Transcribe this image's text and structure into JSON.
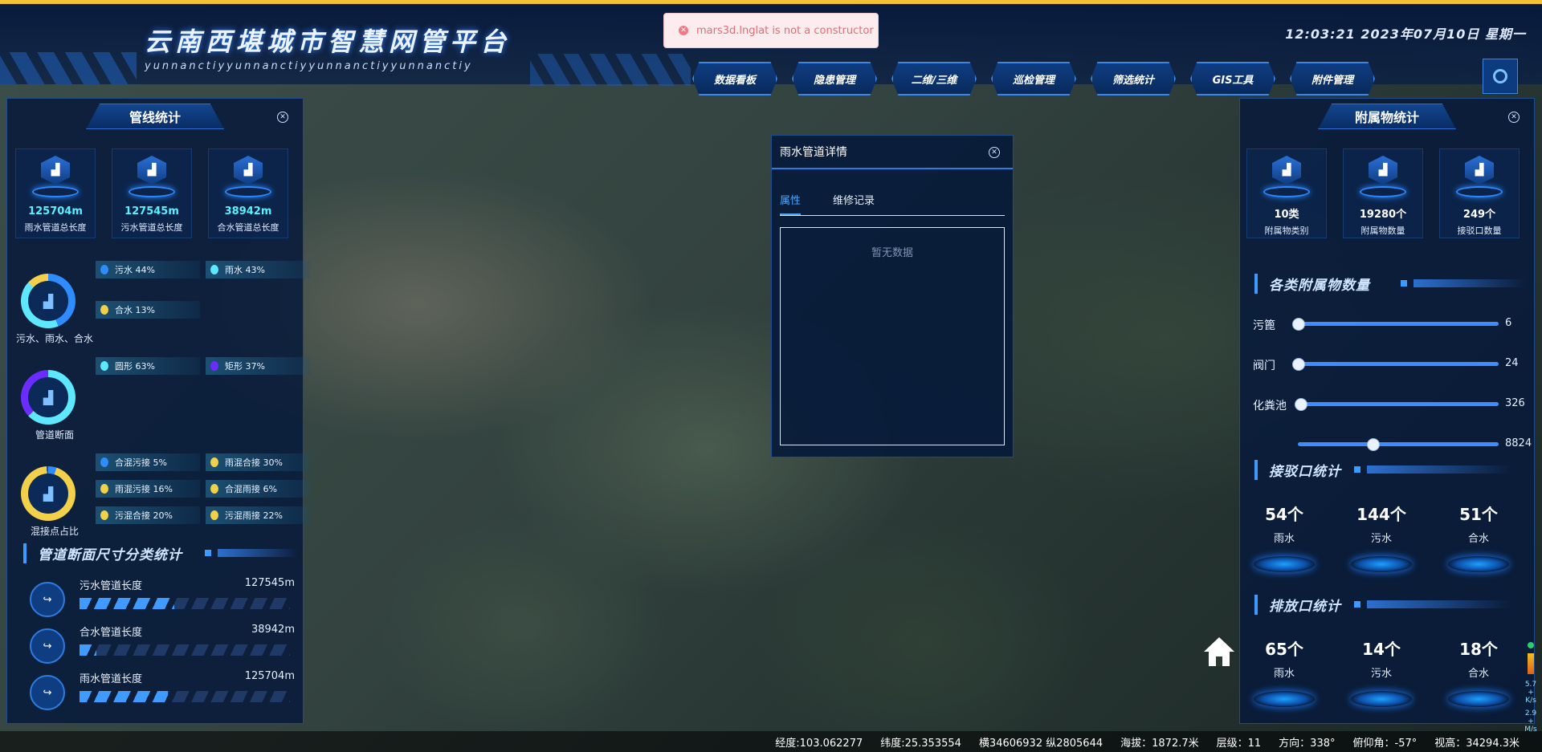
{
  "app": {
    "title": "云南西堪城市智慧网管平台",
    "subtitle": "yunnanctiyyunnanctiyyunnanctiyyunnanctiy",
    "clock": "12:03:21  2023年07月10日  星期一"
  },
  "toast": {
    "message": "mars3d.lnglat is not a constructor"
  },
  "nav": [
    "数据看板",
    "隐患管理",
    "二维/三维",
    "巡检管理",
    "筛选统计",
    "GIS工具",
    "附件管理"
  ],
  "left_panel": {
    "title": "管线统计",
    "stats": [
      {
        "value": "125704m",
        "label": "雨水管道总长度"
      },
      {
        "value": "127545m",
        "label": "污水管道总长度"
      },
      {
        "value": "38942m",
        "label": "合水管道总长度"
      }
    ],
    "donut1": {
      "label": "污水、雨水、合水",
      "tags": [
        {
          "text": "污水 44%",
          "pct": 44,
          "color": "#2f8cff"
        },
        {
          "text": "雨水 43%",
          "pct": 43,
          "color": "#5ee8ff"
        },
        {
          "text": "合水 13%",
          "pct": 13,
          "color": "#f3d04a"
        }
      ]
    },
    "donut2": {
      "label": "管道断面",
      "tags": [
        {
          "text": "圆形 63%",
          "pct": 63,
          "color": "#5ee8ff"
        },
        {
          "text": "矩形 37%",
          "pct": 37,
          "color": "#6a2cff"
        }
      ]
    },
    "donut3": {
      "label": "混接点占比",
      "tags": [
        {
          "text": "合混污接 5%",
          "pct": 5,
          "color": "#2f8cff"
        },
        {
          "text": "雨混合接 30%",
          "pct": 30,
          "color": "#f3d04a"
        },
        {
          "text": "雨混污接 16%",
          "pct": 16,
          "color": "#f3d04a"
        },
        {
          "text": "合混雨接 6%",
          "pct": 6,
          "color": "#f3d04a"
        },
        {
          "text": "污混合接 20%",
          "pct": 20,
          "color": "#f3d04a"
        },
        {
          "text": "污混雨接 22%",
          "pct": 22,
          "color": "#f3d04a"
        }
      ]
    },
    "section_title": "管道断面尺寸分类统计",
    "lengths": [
      {
        "name": "污水管道长度",
        "value": "127545m",
        "fill": 0.45
      },
      {
        "name": "合水管道长度",
        "value": "38942m",
        "fill": 0.08
      },
      {
        "name": "雨水管道长度",
        "value": "125704m",
        "fill": 0.42
      }
    ]
  },
  "detail": {
    "title": "雨水管道详情",
    "tabs": [
      "属性",
      "维修记录"
    ],
    "empty_text": "暂无数据"
  },
  "right_panel": {
    "title": "附属物统计",
    "stats": [
      {
        "value": "10类",
        "label": "附属物类别"
      },
      {
        "value": "19280个",
        "label": "附属物数量"
      },
      {
        "value": "249个",
        "label": "接驳口数量"
      }
    ],
    "section1": "各类附属物数量",
    "sliders": [
      {
        "label": "污篦",
        "value": "6",
        "pos": 0.0
      },
      {
        "label": "阀门",
        "value": "24",
        "pos": 0.0
      },
      {
        "label": "化粪池",
        "value": "326",
        "pos": 0.01
      },
      {
        "label": "",
        "value": "8824",
        "pos": 0.37
      }
    ],
    "section2": "接驳口统计",
    "connectors": [
      {
        "value": "54个",
        "label": "雨水"
      },
      {
        "value": "144个",
        "label": "污水"
      },
      {
        "value": "51个",
        "label": "合水"
      }
    ],
    "section3": "排放口统计",
    "outlets": [
      {
        "value": "65个",
        "label": "雨水"
      },
      {
        "value": "14个",
        "label": "污水"
      },
      {
        "value": "18个",
        "label": "合水"
      }
    ]
  },
  "status_bar": {
    "lng": "经度:103.062277",
    "lat": "纬度:25.353554",
    "xy": "横34606932 纵2805644",
    "alt": "海拔：1872.7米",
    "level": "层级：11",
    "heading": "方向：338°",
    "pitch": "俯仰角：-57°",
    "view_height": "视高：34294.3米"
  },
  "scale": {
    "top": "5.7",
    "top_unit": "+ K/s",
    "bottom": "2.9",
    "bottom_unit": "+ M/s"
  }
}
